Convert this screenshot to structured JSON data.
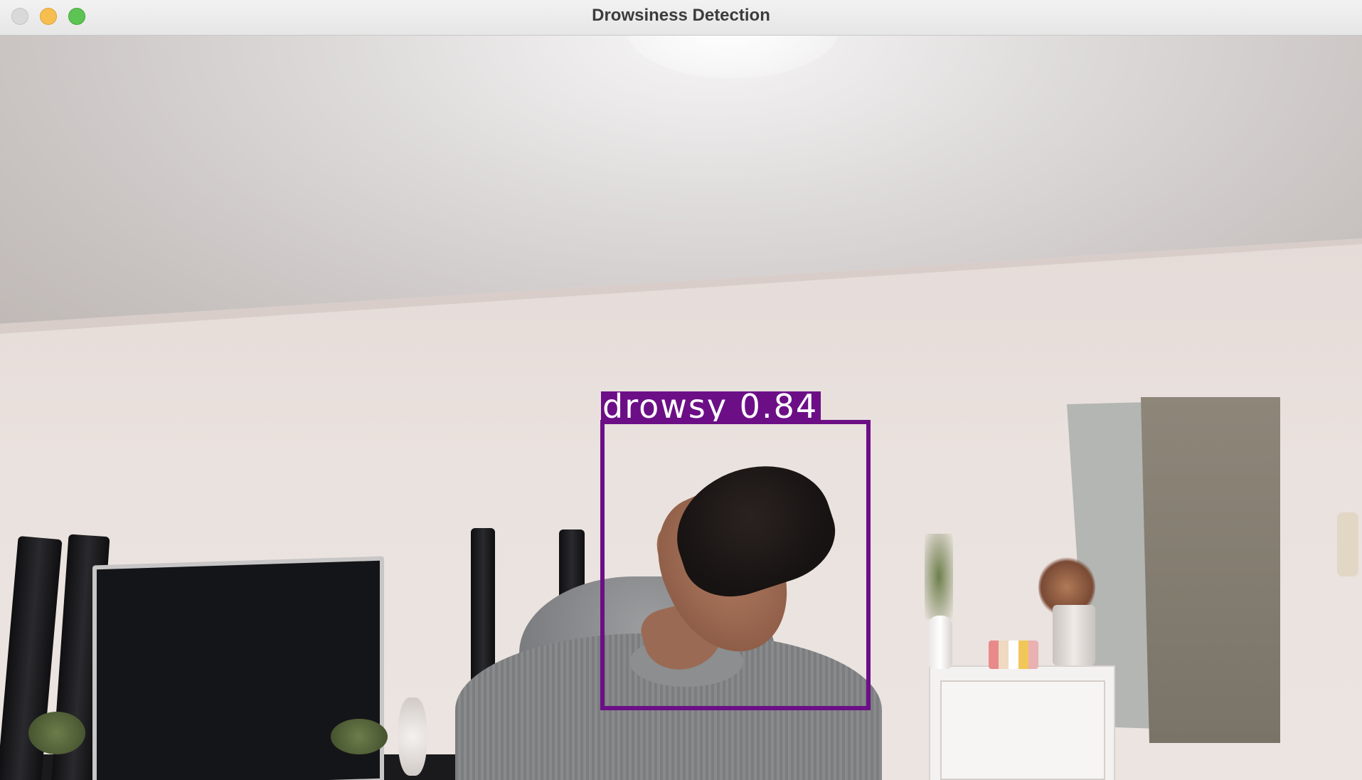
{
  "window": {
    "title": "Drowsiness Detection",
    "controls": [
      "close",
      "minimize",
      "maximize"
    ]
  },
  "detection": {
    "label": "drowsy 0.84",
    "class": "drowsy",
    "confidence": 0.84,
    "box_color": "#6c0f87",
    "label_text_color": "#ffffff"
  },
  "colors": {
    "close": "#d9d9d9",
    "minimize": "#f6be4f",
    "maximize": "#5dc453"
  }
}
